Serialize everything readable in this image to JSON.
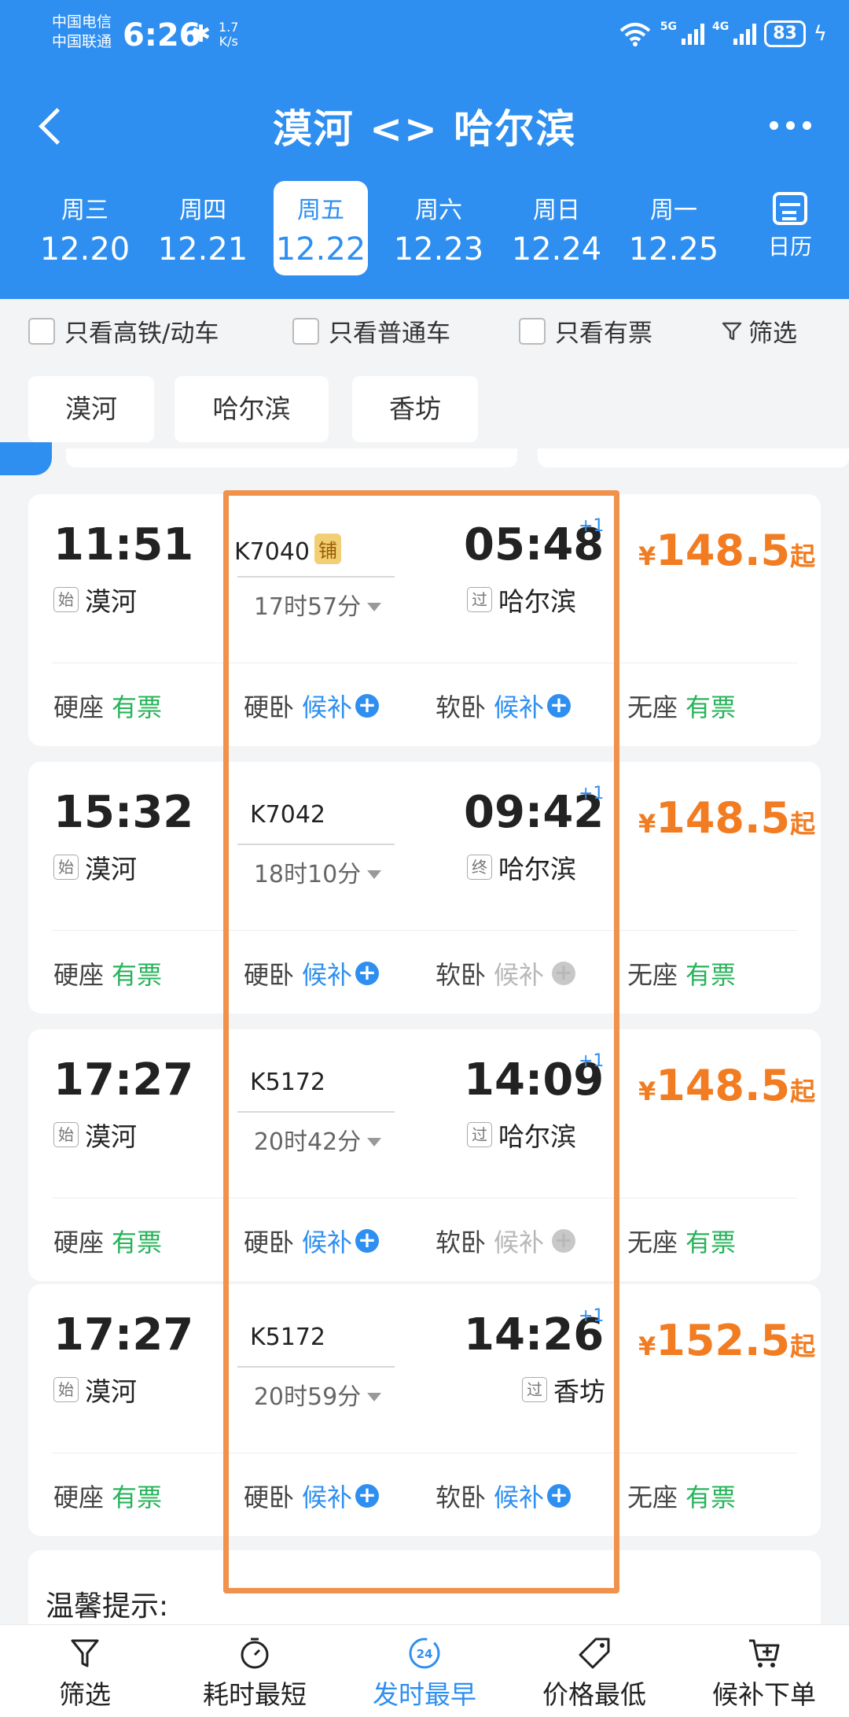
{
  "status": {
    "carrier1": "中国电信",
    "carrier2": "中国联通",
    "time": "6:26",
    "speed_value": "1.7",
    "speed_unit": "K/s",
    "net_5g": "5G",
    "net_4g": "4G",
    "battery": "83"
  },
  "nav": {
    "title": "漠河 <> 哈尔滨"
  },
  "dates": [
    {
      "weekday": "周三",
      "date": "12.20"
    },
    {
      "weekday": "周四",
      "date": "12.21"
    },
    {
      "weekday": "周五",
      "date": "12.22"
    },
    {
      "weekday": "周六",
      "date": "12.23"
    },
    {
      "weekday": "周日",
      "date": "12.24"
    },
    {
      "weekday": "周一",
      "date": "12.25"
    }
  ],
  "calendar_label": "日历",
  "filters": {
    "highspeed": "只看高铁/动车",
    "normal": "只看普通车",
    "available": "只看有票",
    "filter": "筛选"
  },
  "stations": [
    "漠河",
    "哈尔滨",
    "香坊"
  ],
  "trains": [
    {
      "dep_time": "11:51",
      "dep_tag": "始",
      "dep_station": "漠河",
      "train_no": "K7040",
      "badge": "铺",
      "duration": "17时57分",
      "arr_time": "05:48",
      "arr_plus": "+1",
      "arr_tag": "过",
      "arr_station": "哈尔滨",
      "price_sym": "¥",
      "price": "148.5",
      "price_suffix": "起",
      "seats": [
        {
          "name": "硬座",
          "status": "有票"
        },
        {
          "name": "硬卧",
          "status": "候补"
        },
        {
          "name": "软卧",
          "status": "候补"
        },
        {
          "name": "无座",
          "status": "有票"
        }
      ]
    },
    {
      "dep_time": "15:32",
      "dep_tag": "始",
      "dep_station": "漠河",
      "train_no": "K7042",
      "badge": "",
      "duration": "18时10分",
      "arr_time": "09:42",
      "arr_plus": "+1",
      "arr_tag": "终",
      "arr_station": "哈尔滨",
      "price_sym": "¥",
      "price": "148.5",
      "price_suffix": "起",
      "seats": [
        {
          "name": "硬座",
          "status": "有票"
        },
        {
          "name": "硬卧",
          "status": "候补"
        },
        {
          "name": "软卧",
          "status": "候补"
        },
        {
          "name": "无座",
          "status": "有票"
        }
      ]
    },
    {
      "dep_time": "17:27",
      "dep_tag": "始",
      "dep_station": "漠河",
      "train_no": "K5172",
      "badge": "",
      "duration": "20时42分",
      "arr_time": "14:09",
      "arr_plus": "+1",
      "arr_tag": "过",
      "arr_station": "哈尔滨",
      "price_sym": "¥",
      "price": "148.5",
      "price_suffix": "起",
      "seats": [
        {
          "name": "硬座",
          "status": "有票"
        },
        {
          "name": "硬卧",
          "status": "候补"
        },
        {
          "name": "软卧",
          "status": "候补"
        },
        {
          "name": "无座",
          "status": "有票"
        }
      ]
    },
    {
      "dep_time": "17:27",
      "dep_tag": "始",
      "dep_station": "漠河",
      "train_no": "K5172",
      "badge": "",
      "duration": "20时59分",
      "arr_time": "14:26",
      "arr_plus": "+1",
      "arr_tag": "过",
      "arr_station": "香坊",
      "price_sym": "¥",
      "price": "152.5",
      "price_suffix": "起",
      "seats": [
        {
          "name": "硬座",
          "status": "有票"
        },
        {
          "name": "硬卧",
          "status": "候补"
        },
        {
          "name": "软卧",
          "status": "候补"
        },
        {
          "name": "无座",
          "status": "有票"
        }
      ]
    }
  ],
  "tips": "温馨提示:",
  "tabbar": [
    {
      "label": "筛选",
      "icon": "funnel-icon"
    },
    {
      "label": "耗时最短",
      "icon": "stopwatch-icon"
    },
    {
      "label": "发时最早",
      "icon": "clock-24-icon",
      "badge": "24"
    },
    {
      "label": "价格最低",
      "icon": "price-tag-icon"
    },
    {
      "label": "候补下单",
      "icon": "cart-plus-icon"
    }
  ],
  "colors": {
    "brand": "#2f8ff0",
    "price": "#f27c21",
    "available": "#27b35a",
    "highlight": "#f0914c"
  }
}
